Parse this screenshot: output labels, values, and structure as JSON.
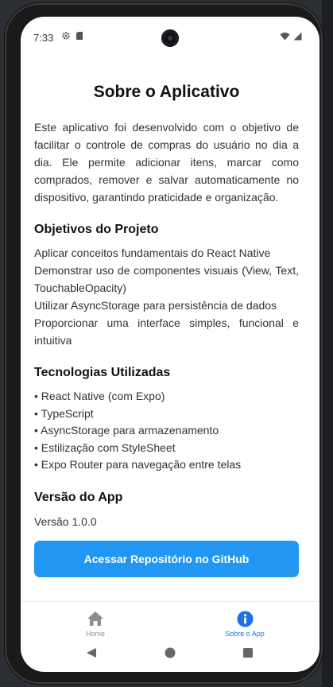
{
  "status_bar": {
    "time": "7:33"
  },
  "page": {
    "title": "Sobre o Aplicativo",
    "intro": "Este aplicativo foi desenvolvido com o objetivo de facilitar o controle de compras do usuário no dia a dia. Ele permite adicionar itens, marcar como comprados, remover e salvar automaticamente no dispositivo, garantindo praticidade e organização."
  },
  "objectives": {
    "title": "Objetivos do Projeto",
    "items": [
      "Aplicar conceitos fundamentais do React Native",
      "Demonstrar uso de componentes visuais (View, Text, TouchableOpacity)",
      "Utilizar AsyncStorage para persistência de dados",
      "Proporcionar uma interface simples, funcional e intuitiva"
    ]
  },
  "technologies": {
    "title": "Tecnologias Utilizadas",
    "items": [
      "• React Native (com Expo)",
      "• TypeScript",
      "• AsyncStorage para armazenamento",
      "• Estilização com StyleSheet",
      "• Expo Router para navegação entre telas"
    ]
  },
  "version": {
    "title": "Versão do App",
    "text": "Versão 1.0.0"
  },
  "github_button": {
    "label": "Acessar Repositório no GitHub"
  },
  "tabs": [
    {
      "label": "Home",
      "icon": "home-icon",
      "active": false
    },
    {
      "label": "Sobre o App",
      "icon": "info-icon",
      "active": true
    }
  ],
  "colors": {
    "accent": "#2196f3",
    "active_tab": "#1a73e8",
    "inactive_tab": "#8e8e8e"
  }
}
